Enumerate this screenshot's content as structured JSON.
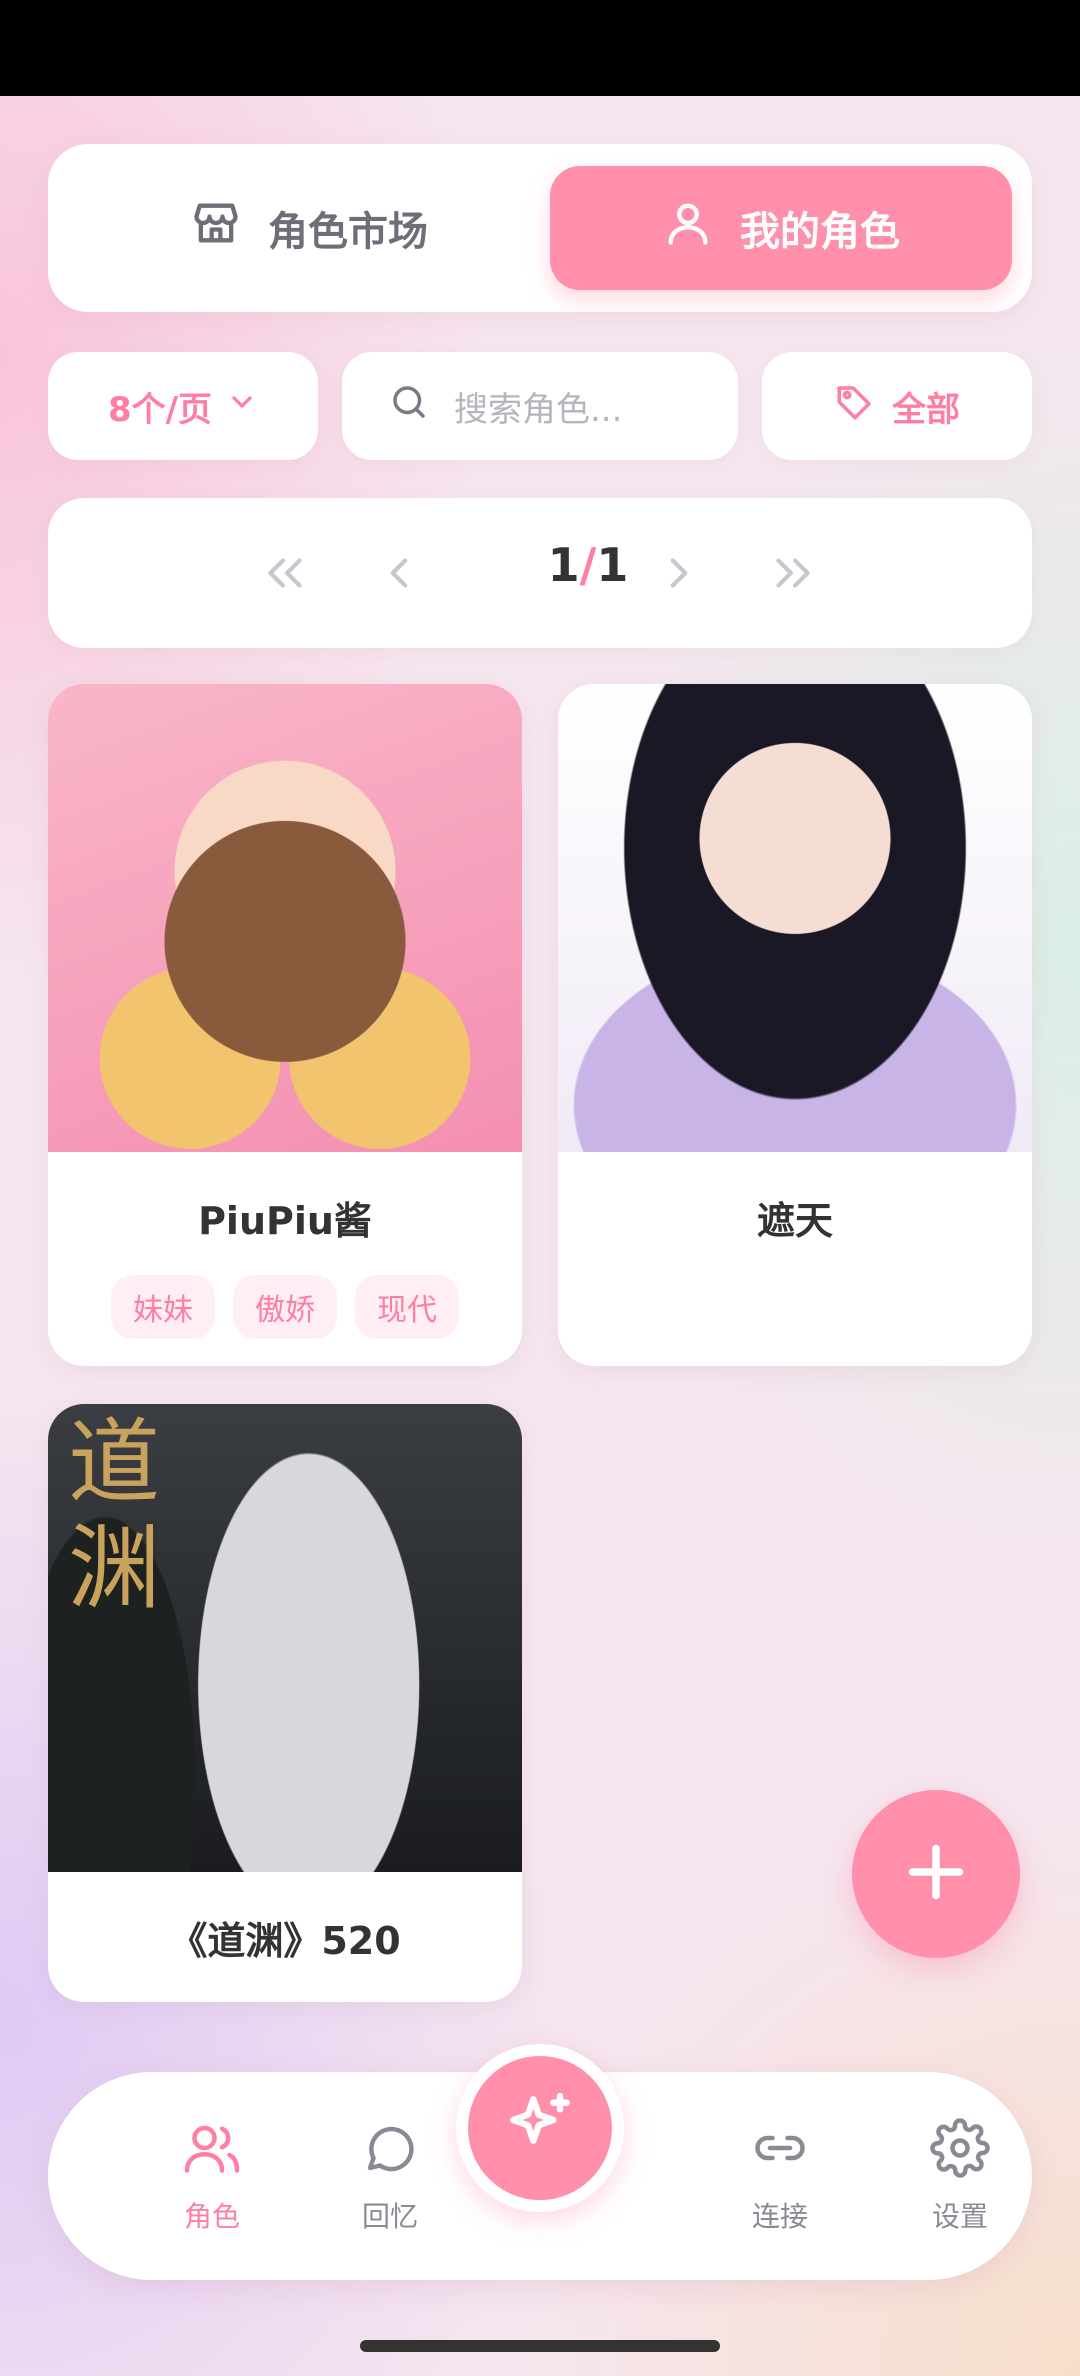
{
  "tabs": {
    "market": "角色市场",
    "mine": "我的角色"
  },
  "filters": {
    "per_page": "8个/页",
    "search_placeholder": "搜索角色...",
    "tag": "全部"
  },
  "pager": {
    "current": "1",
    "separator": "/",
    "total": "1"
  },
  "cards": [
    {
      "name": "PiuPiu酱",
      "tags": [
        "妹妹",
        "傲娇",
        "现代"
      ]
    },
    {
      "name": "遮天",
      "tags": []
    },
    {
      "name": "《道渊》520",
      "tags": [],
      "image_text": "道\n渊"
    }
  ],
  "nav": {
    "roles": "角色",
    "memories": "回忆",
    "connect": "连接",
    "settings": "设置"
  },
  "colors": {
    "accent": "#ff8fab",
    "accent_text": "#ff7fa3",
    "muted": "#8a8a94"
  }
}
